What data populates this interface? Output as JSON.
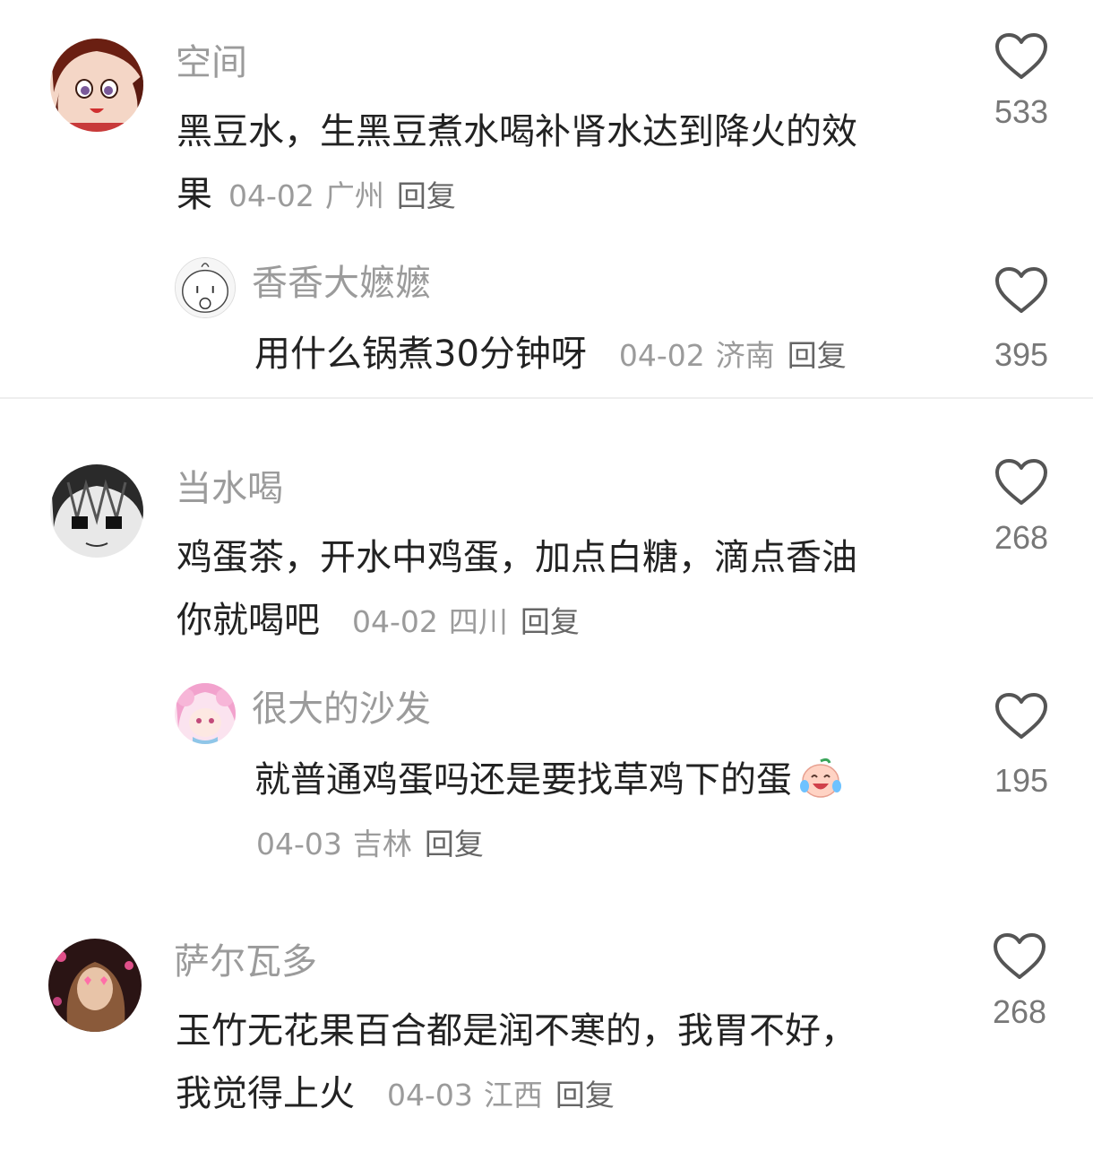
{
  "comments": [
    {
      "username": "空间",
      "text": "黑豆水，生黑豆煮水喝补肾水达到降火的效",
      "text_wrap": "果",
      "date": "04-02",
      "location": "广州",
      "reply_label": "回复",
      "likes": "533",
      "replies": [
        {
          "username": "香香大嬷嬷",
          "text": "用什么锅煮30分钟呀",
          "date": "04-02",
          "location": "济南",
          "reply_label": "回复",
          "likes": "395"
        }
      ]
    },
    {
      "username": "当水喝",
      "text": "鸡蛋茶，开水中鸡蛋，加点白糖，滴点香油",
      "text_wrap": "你就喝吧",
      "date": "04-02",
      "location": "四川",
      "reply_label": "回复",
      "likes": "268",
      "replies": [
        {
          "username": "很大的沙发",
          "text": "就普通鸡蛋吗还是要找草鸡下的蛋",
          "emoji": "laughing-crying-emoji",
          "date": "04-03",
          "location": "吉林",
          "reply_label": "回复",
          "likes": "195"
        }
      ]
    },
    {
      "username": "萨尔瓦多",
      "text": "玉竹无花果百合都是润不寒的，我胃不好，",
      "text_wrap": "我觉得上火",
      "date": "04-03",
      "location": "江西",
      "reply_label": "回复",
      "likes": "268"
    }
  ],
  "colors": {
    "username": "#9b9b9b",
    "text": "#222222",
    "meta": "#9b9b9b",
    "reply_link": "#666666",
    "heart_outline": "#555555",
    "divider": "#eeeeee"
  }
}
